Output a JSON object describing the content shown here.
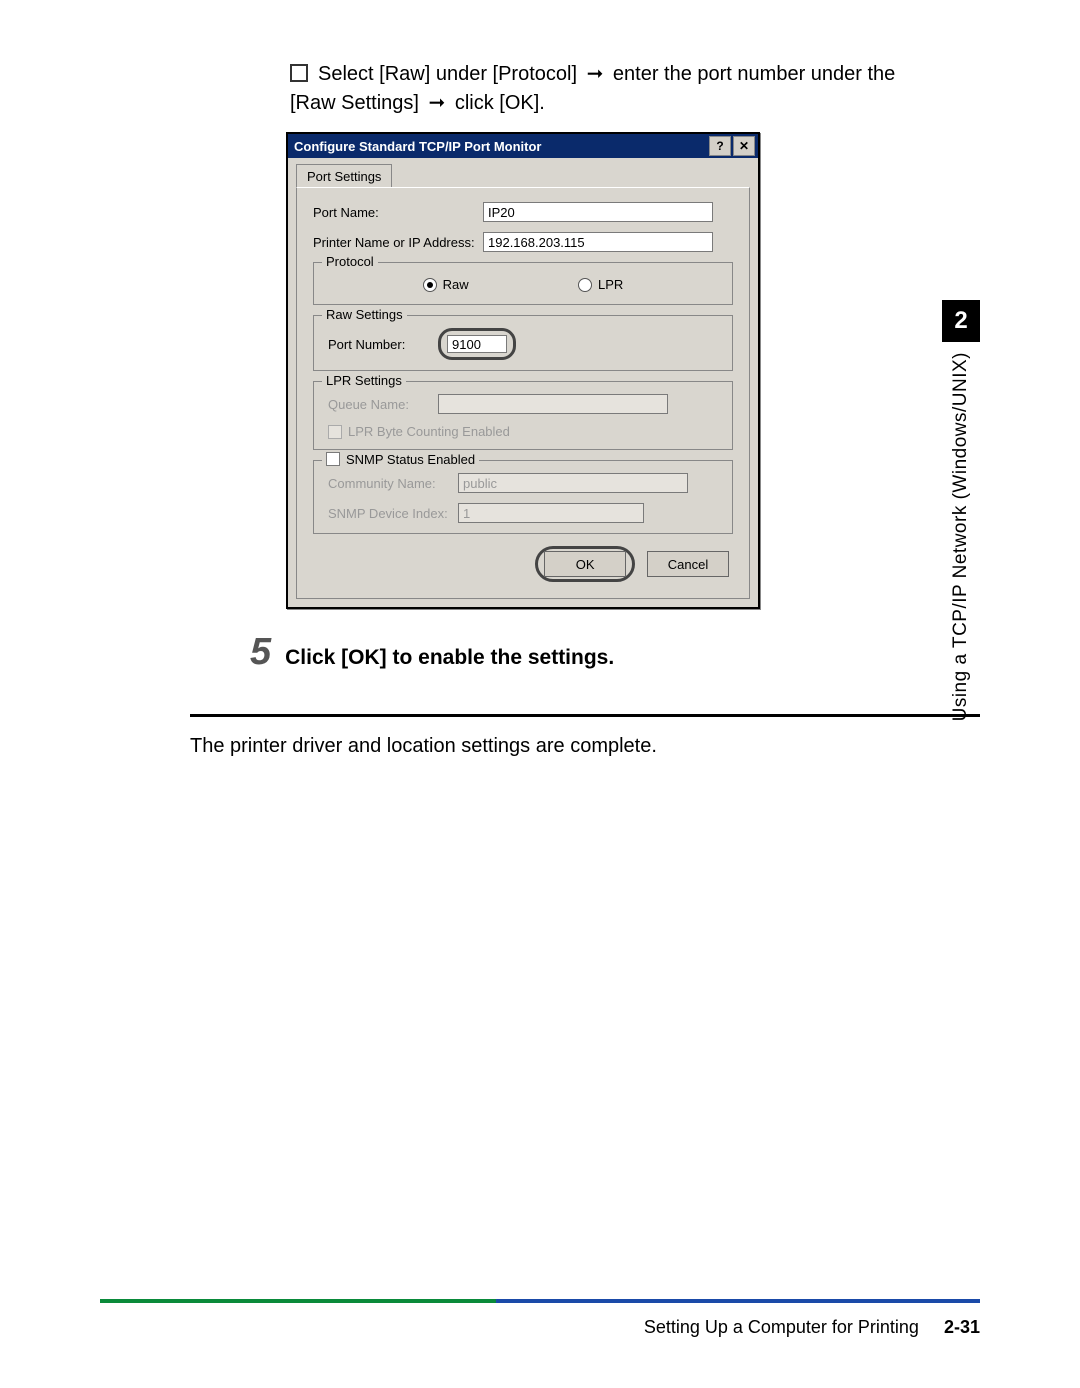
{
  "instruction": {
    "prefix": "Select [Raw] under [Protocol] ",
    "arrow1": "➞",
    "mid": " enter the port number under the [Raw Settings] ",
    "arrow2": "➞",
    "suffix": " click [OK]."
  },
  "dialog": {
    "title": "Configure Standard TCP/IP Port Monitor",
    "help_glyph": "?",
    "close_glyph": "✕",
    "tab": "Port Settings",
    "port_name_label": "Port Name:",
    "port_name_value": "IP20",
    "printer_label": "Printer Name or IP Address:",
    "printer_value": "192.168.203.115",
    "protocol_legend": "Protocol",
    "raw_label": "Raw",
    "lpr_label": "LPR",
    "raw_settings_legend": "Raw Settings",
    "port_number_label": "Port Number:",
    "port_number_value": "9100",
    "lpr_settings_legend": "LPR Settings",
    "queue_name_label": "Queue Name:",
    "queue_name_value": "",
    "lpr_byte_label": "LPR Byte Counting Enabled",
    "snmp_legend": "SNMP Status Enabled",
    "community_label": "Community Name:",
    "community_value": "public",
    "snmp_index_label": "SNMP Device Index:",
    "snmp_index_value": "1",
    "ok_label": "OK",
    "cancel_label": "Cancel"
  },
  "step": {
    "number": "5",
    "text": "Click [OK] to enable the settings."
  },
  "complete_text": "The printer driver and location settings are complete.",
  "footer": {
    "section": "Setting Up a Computer for Printing",
    "page": "2-31"
  },
  "side": {
    "chapter": "2",
    "label": "Using a TCP/IP Network (Windows/UNIX)"
  }
}
